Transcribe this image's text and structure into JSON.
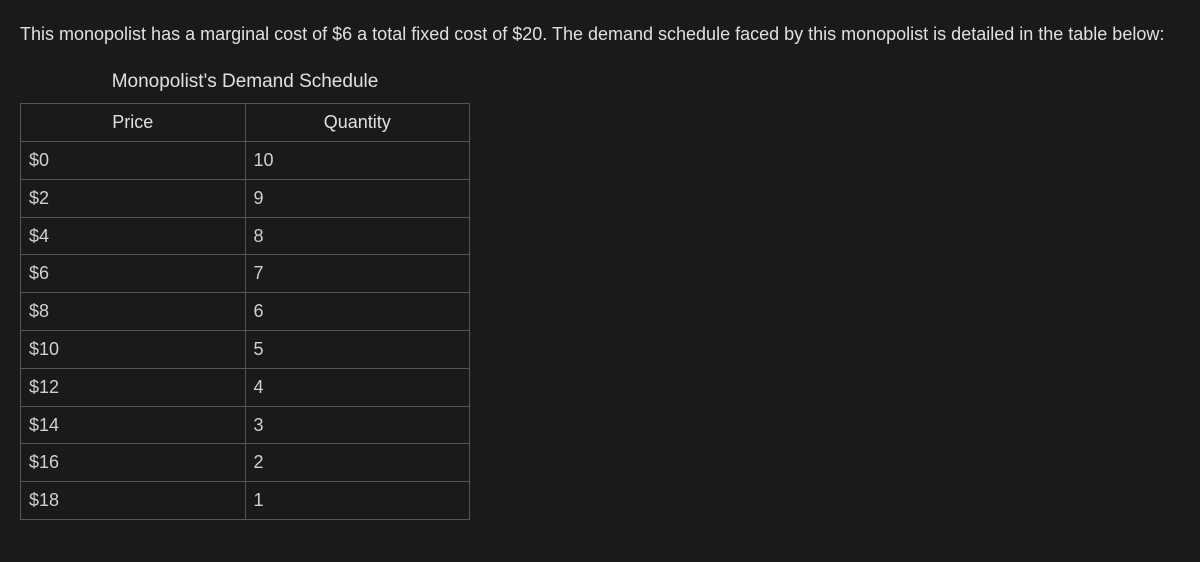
{
  "intro": "This monopolist has a marginal cost of $6 a total fixed cost of $20. The demand schedule faced by this monopolist is detailed in the table below:",
  "table": {
    "caption": "Monopolist's Demand Schedule",
    "headers": {
      "price": "Price",
      "quantity": "Quantity"
    },
    "rows": [
      {
        "price": "$0",
        "quantity": "10"
      },
      {
        "price": "$2",
        "quantity": "9"
      },
      {
        "price": "$4",
        "quantity": "8"
      },
      {
        "price": "$6",
        "quantity": "7"
      },
      {
        "price": "$8",
        "quantity": "6"
      },
      {
        "price": "$10",
        "quantity": "5"
      },
      {
        "price": "$12",
        "quantity": "4"
      },
      {
        "price": "$14",
        "quantity": "3"
      },
      {
        "price": "$16",
        "quantity": "2"
      },
      {
        "price": "$18",
        "quantity": "1"
      }
    ]
  }
}
